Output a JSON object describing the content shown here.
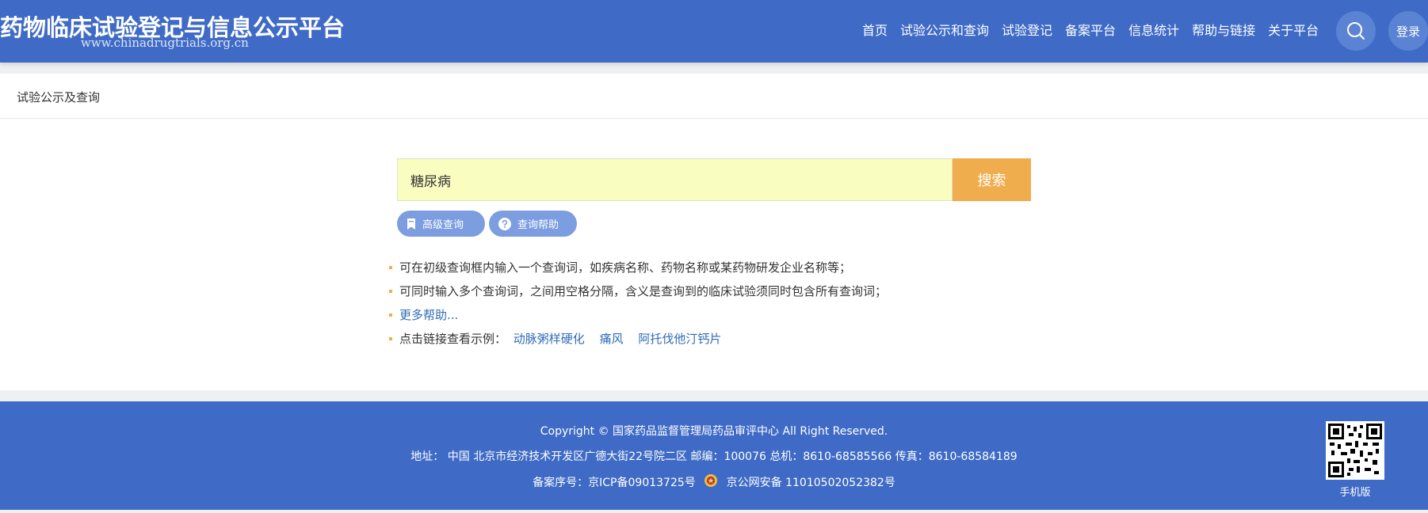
{
  "header": {
    "title": "药物临床试验登记与信息公示平台",
    "url": "www.chinadrugtrials.org.cn",
    "nav": [
      {
        "label": "首页"
      },
      {
        "label": "试验公示和查询"
      },
      {
        "label": "试验登记"
      },
      {
        "label": "备案平台"
      },
      {
        "label": "信息统计"
      },
      {
        "label": "帮助与链接"
      },
      {
        "label": "关于平台"
      }
    ],
    "search_icon": "search-icon",
    "login_label": "登录"
  },
  "breadcrumb": "试验公示及查询",
  "search": {
    "value": "糖尿病",
    "button_label": "搜索",
    "advanced_label": "高级查询",
    "help_label": "查询帮助"
  },
  "tips": {
    "tip1": "可在初级查询框内输入一个查询词，如疾病名称、药物名称或某药物研发企业名称等；",
    "tip2": "可同时输入多个查询词，之间用空格分隔，含义是查询到的临床试验须同时包含所有查询词；",
    "more_help": "更多帮助...",
    "examples_label": "点击链接查看示例：",
    "examples": [
      "动脉粥样硬化",
      "痛风",
      "阿托伐他汀钙片"
    ]
  },
  "footer": {
    "copyright": "Copyright © 国家药品监督管理局药品审评中心 All Right Reserved.",
    "address": "地址： 中国 北京市经济技术开发区广德大街22号院二区 邮编：100076 总机：8610-68585566 传真：8610-68584189",
    "icp": "备案序号：京ICP备09013725号",
    "police": "京公网安备 11010502052382号",
    "mobile_label": "手机版"
  },
  "colors": {
    "brand_blue": "#3f6bc6",
    "accent_orange": "#f0ad4e",
    "search_bg": "#fafdc0",
    "pill_blue": "#7c9de0",
    "link_blue": "#2f6bb7"
  }
}
